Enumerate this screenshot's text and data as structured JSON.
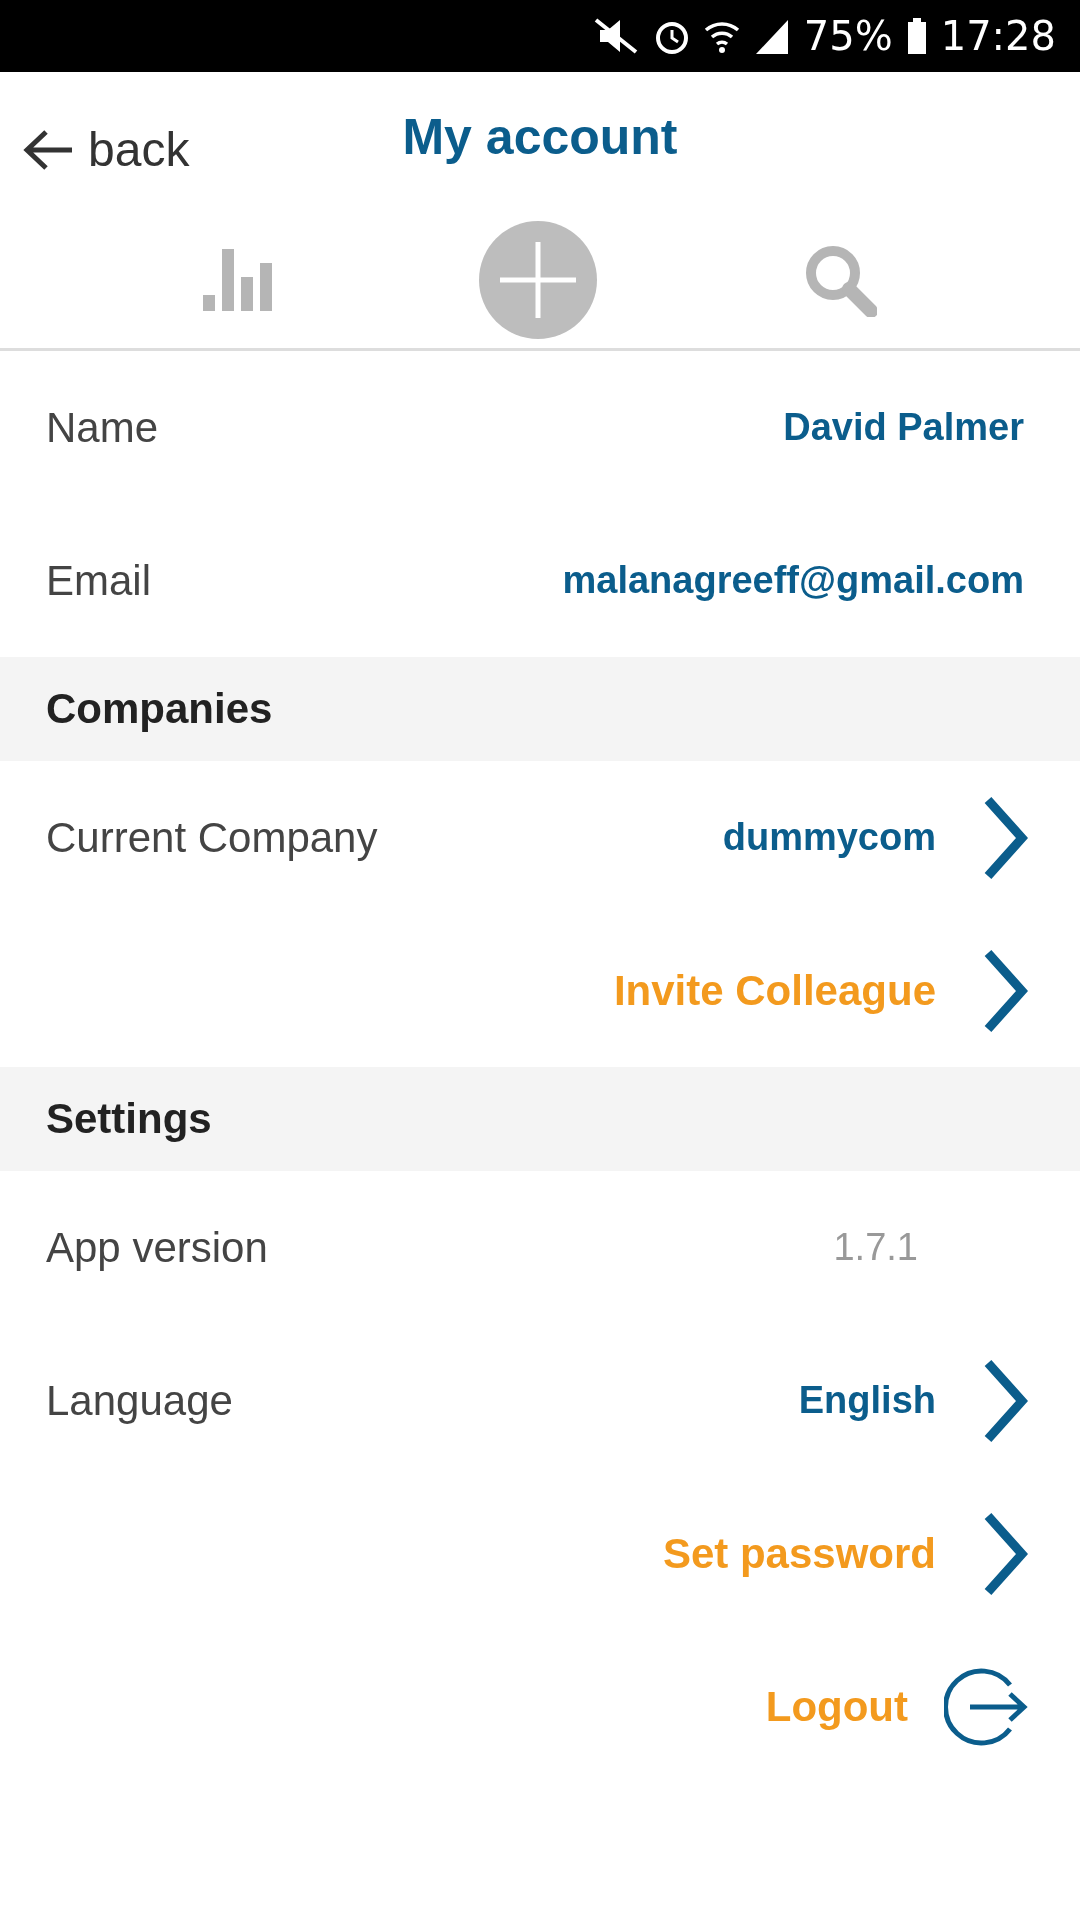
{
  "status_bar": {
    "battery": "75%",
    "time": "17:28"
  },
  "header": {
    "back": "back",
    "title": "My account"
  },
  "sections": [
    {
      "rows": [
        {
          "kind": "info",
          "label": "Name",
          "value": "David Palmer"
        },
        {
          "kind": "info",
          "label": "Email",
          "value": "malanagreeff@gmail.com"
        }
      ]
    },
    {
      "title": "Companies",
      "rows": [
        {
          "kind": "nav",
          "label": "Current Company",
          "value": "dummycom"
        },
        {
          "kind": "action",
          "value": "Invite Colleague"
        }
      ]
    },
    {
      "title": "Settings",
      "rows": [
        {
          "kind": "version",
          "label": "App version",
          "value": "1.7.1"
        },
        {
          "kind": "nav",
          "label": "Language",
          "value": "English"
        },
        {
          "kind": "action",
          "value": "Set password"
        },
        {
          "kind": "logout",
          "value": "Logout"
        }
      ]
    }
  ]
}
